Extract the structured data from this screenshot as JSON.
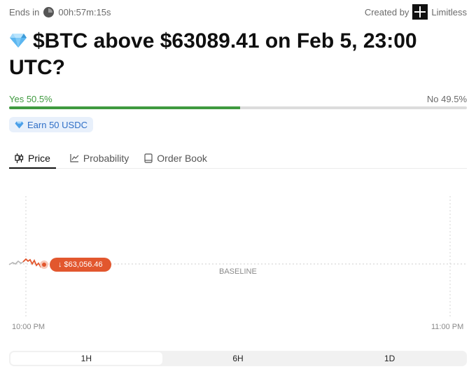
{
  "header": {
    "ends_label": "Ends in",
    "countdown": "00h:57m:15s",
    "created_by_label": "Created by",
    "creator_name": "Limitless"
  },
  "market": {
    "title": "$BTC above $63089.41 on Feb 5, 23:00 UTC?",
    "yes_label": "Yes 50.5%",
    "no_label": "No 49.5%",
    "yes_percent": 50.5,
    "earn_label": "Earn 50 USDC"
  },
  "tabs": [
    {
      "label": "Price",
      "icon": "candlestick-icon",
      "active": true
    },
    {
      "label": "Probability",
      "icon": "line-chart-icon",
      "active": false
    },
    {
      "label": "Order Book",
      "icon": "book-icon",
      "active": false
    }
  ],
  "chart": {
    "current_price_label": "↓ $63,056.46",
    "baseline_label": "BASELINE",
    "x_start_label": "10:00 PM",
    "x_end_label": "11:00 PM"
  },
  "ranges": [
    {
      "label": "1H",
      "active": true
    },
    {
      "label": "6H",
      "active": false
    },
    {
      "label": "1D",
      "active": false
    }
  ],
  "colors": {
    "yes_green": "#3f9a3f",
    "price_down_red": "#e2572e",
    "earn_blue": "#2f6fc7"
  }
}
